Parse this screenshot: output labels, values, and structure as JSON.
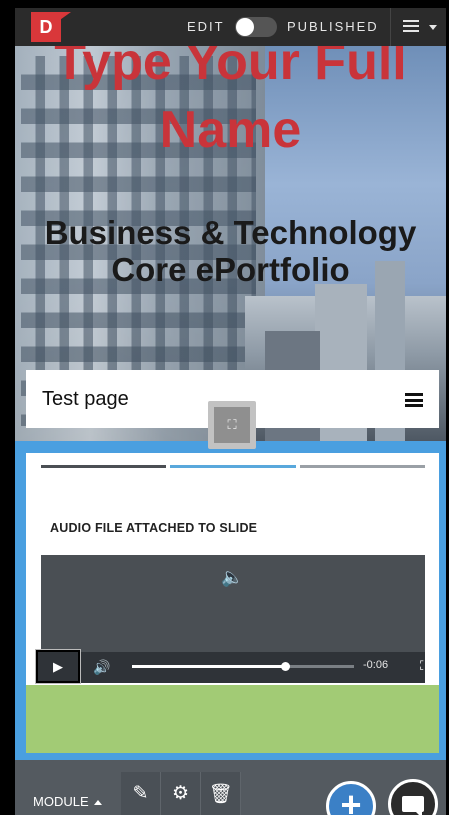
{
  "topbar": {
    "logo_letter": "D",
    "edit_label": "EDIT",
    "published_label": "PUBLISHED",
    "mode_toggle_on": false,
    "menu_icon": "hamburger-icon"
  },
  "hero": {
    "name": "Type Your Full Name",
    "subtitle": "Business & Technology Core ePortfolio",
    "name_color": "#c9343a"
  },
  "page": {
    "title": "Test page",
    "menu_icon": "hamburger-icon",
    "expand_icon": "expand-icon"
  },
  "module": {
    "progress_segments": [
      "done",
      "current",
      "pending"
    ],
    "heading": "AUDIO FILE ATTACHED TO SLIDE",
    "audio": {
      "speaker_icon": "speaker-icon",
      "play_icon": "play-icon",
      "volume_icon": "volume-icon",
      "progress_fraction": 0.69,
      "time_remaining": "-0:06",
      "fullscreen_icon": "fullscreen-icon"
    }
  },
  "bottombar": {
    "module_label": "MODULE",
    "tools": [
      {
        "name": "edit-icon",
        "glyph": "✎"
      },
      {
        "name": "gear-icon",
        "glyph": "⚙"
      },
      {
        "name": "trash-icon",
        "glyph": "🗑"
      }
    ],
    "add_glyph": "+",
    "accent": "#3b80c6"
  },
  "colors": {
    "frame_blue": "#4a9fe0",
    "bar_dark": "#2b2b2b",
    "green_block": "#a2cb75"
  }
}
